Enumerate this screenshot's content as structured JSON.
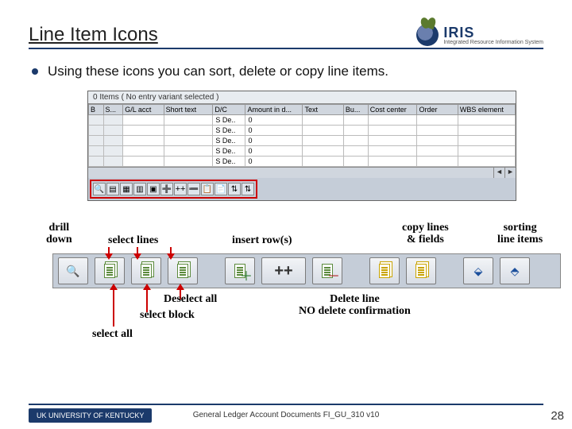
{
  "header": {
    "title": "Line Item Icons",
    "logo_text": "IRIS",
    "logo_sub": "Integrated Resource\nInformation System"
  },
  "bullet": {
    "text": "Using these icons you can sort, delete or copy line items."
  },
  "screenshot": {
    "caption": "0 Items ( No entry variant selected )",
    "columns": [
      "B",
      "S...",
      "G/L acct",
      "Short text",
      "D/C",
      "Amount in d...",
      "Text",
      "Bu...",
      "Cost center",
      "Order",
      "WBS element"
    ],
    "rows": [
      [
        "",
        "",
        "",
        "",
        "S De..",
        "0",
        "",
        "",
        "",
        "",
        ""
      ],
      [
        "",
        "",
        "",
        "",
        "S De..",
        "0",
        "",
        "",
        "",
        "",
        ""
      ],
      [
        "",
        "",
        "",
        "",
        "S De..",
        "0",
        "",
        "",
        "",
        "",
        ""
      ],
      [
        "",
        "",
        "",
        "",
        "S De..",
        "0",
        "",
        "",
        "",
        "",
        ""
      ],
      [
        "",
        "",
        "",
        "",
        "S De..",
        "0",
        "",
        "",
        "",
        "",
        ""
      ]
    ],
    "toolbar_glyphs": [
      "🔍",
      "▤",
      "▦",
      "▥",
      "▣",
      "➕",
      "++",
      "➖",
      "📋",
      "📄",
      "⇅",
      "⇅"
    ]
  },
  "labels": {
    "drill": "drill\ndown",
    "select_lines": "select lines",
    "insert_rows": "insert row(s)",
    "copy": "copy lines\n& fields",
    "sort": "sorting\nline items",
    "deselect_all": "Deselect all",
    "select_block": "select block",
    "select_all": "select all",
    "delete_line": "Delete line\nNO delete confirmation"
  },
  "icons": {
    "plusplus": "++"
  },
  "footer": {
    "org": "UK  UNIVERSITY OF KENTUCKY",
    "text": "General Ledger Account Documents FI_GU_310 v10",
    "page": "28"
  }
}
